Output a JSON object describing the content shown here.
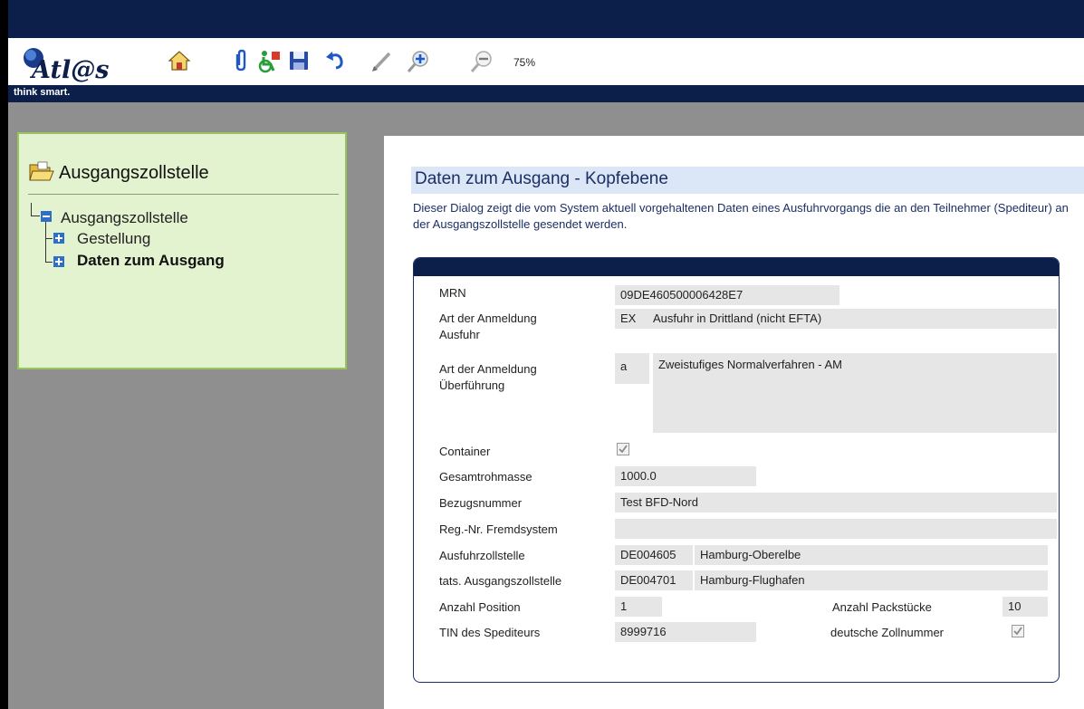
{
  "toolbar": {
    "logo_text": "Atl@s",
    "zoom": "75%",
    "icons": [
      "home-icon",
      "attachment-icon",
      "accessibility-icon",
      "save-icon",
      "undo-icon",
      "pen-icon",
      "zoom-in-icon",
      "zoom-out-icon"
    ]
  },
  "slogan": "think smart.",
  "nav": {
    "title": "Ausgangszollstelle",
    "root": "Ausgangszollstelle",
    "items": [
      {
        "label": "Gestellung",
        "active": false
      },
      {
        "label": "Daten zum Ausgang",
        "active": true
      }
    ]
  },
  "content": {
    "title": "Daten zum Ausgang - Kopfebene",
    "description": "Dieser Dialog zeigt die vom System aktuell vorgehaltenen Daten eines Ausfuhrvorgangs die an den Teilnehmer (Spediteur) an der Ausgangszollstelle gesendet werden."
  },
  "form": {
    "mrn": {
      "label": "MRN",
      "value": "09DE460500006428E7"
    },
    "art_ausfuhr": {
      "label1": "Art der Anmeldung",
      "label2": "Ausfuhr",
      "code": "EX",
      "text": "Ausfuhr in Drittland (nicht EFTA)"
    },
    "art_ueberfuehrung": {
      "label1": "Art der Anmeldung",
      "label2": "Überführung",
      "code": "a",
      "text": "Zweistufiges Normalverfahren - AM"
    },
    "container": {
      "label": "Container",
      "checked": true
    },
    "gesamtrohmasse": {
      "label": "Gesamtrohmasse",
      "value": "1000.0"
    },
    "bezugsnummer": {
      "label": "Bezugsnummer",
      "value": "Test BFD-Nord"
    },
    "reg_nr": {
      "label": "Reg.-Nr. Fremdsystem",
      "value": ""
    },
    "ausfuhrzollstelle": {
      "label": "Ausfuhrzollstelle",
      "code": "DE004605",
      "name": "Hamburg-Oberelbe"
    },
    "tats_ausgang": {
      "label": "tats. Ausgangszollstelle",
      "code": "DE004701",
      "name": "Hamburg-Flughafen"
    },
    "anzahl_position": {
      "label": "Anzahl Position",
      "value": "1"
    },
    "anzahl_packstuecke": {
      "label": "Anzahl Packstücke",
      "value": "10"
    },
    "tin": {
      "label": "TIN des Spediteurs",
      "value": "8999716"
    },
    "deutsche_zollnummer": {
      "label": "deutsche Zollnummer",
      "checked": true
    }
  },
  "colors": {
    "navy": "#0c1f4a",
    "nav_bg": "#e3f2cf",
    "nav_border": "#98c45e",
    "field_bg": "#e6e6e6",
    "heading_bg": "#dbe6f6"
  }
}
